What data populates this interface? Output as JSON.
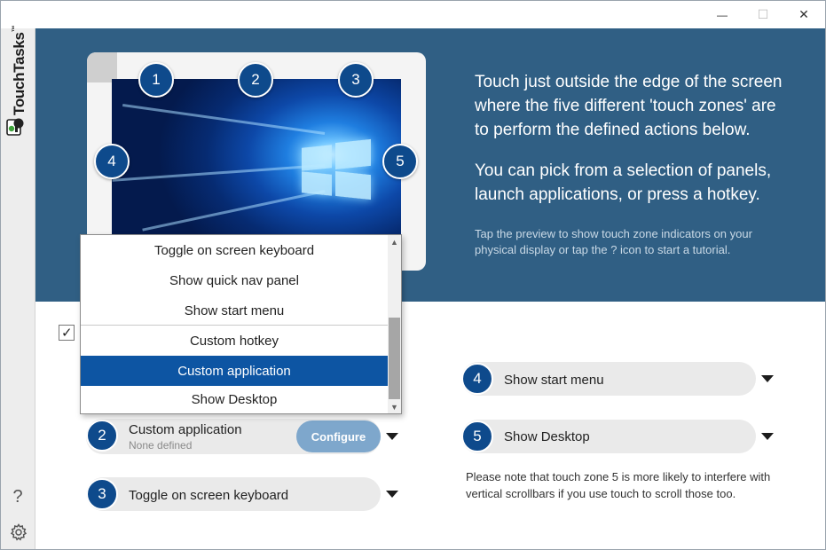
{
  "window": {
    "minimize_glyph": "—",
    "maximize_glyph": "☐",
    "close_glyph": "✕"
  },
  "sidebar": {
    "brand": "TouchTasks",
    "brand_mark": "™",
    "help_glyph": "?",
    "help_icon": "question-icon",
    "settings_icon": "gear-icon"
  },
  "banner": {
    "background_color": "#305f84",
    "zones": [
      "1",
      "2",
      "3",
      "4",
      "5"
    ],
    "intro_line_1": "Touch just outside the edge of the screen where the five different 'touch zones' are to perform the defined actions below.",
    "intro_line_2": "You can pick from a selection of panels, launch applications, or press a hotkey.",
    "hint": "Tap the preview to show touch zone indicators on your physical display or tap the ? icon to start a tutorial."
  },
  "dropdown": {
    "items": [
      "Toggle on screen keyboard",
      "Show quick nav panel",
      "Show start menu",
      "Custom hotkey",
      "Custom application",
      "Show Desktop"
    ],
    "selected": "Custom application",
    "scroll_up_glyph": "▲",
    "scroll_down_glyph": "▼"
  },
  "zones": {
    "zone2": {
      "number": "2",
      "action": "Custom application",
      "sub": "None defined",
      "configure_label": "Configure"
    },
    "zone3": {
      "number": "3",
      "action": "Toggle on screen keyboard"
    },
    "zone4": {
      "number": "4",
      "action": "Show start menu"
    },
    "zone5": {
      "number": "5",
      "action": "Show Desktop"
    }
  },
  "checkbox_checked": true,
  "checkbox_glyph": "✓",
  "note": "Please note that touch zone 5 is more likely to interfere with vertical scrollbars if you use touch to scroll those too.",
  "colors": {
    "accent": "#0e4a8c",
    "selected": "#0d55a3",
    "configure": "#7ea7cc",
    "row": "#eaeaea"
  }
}
